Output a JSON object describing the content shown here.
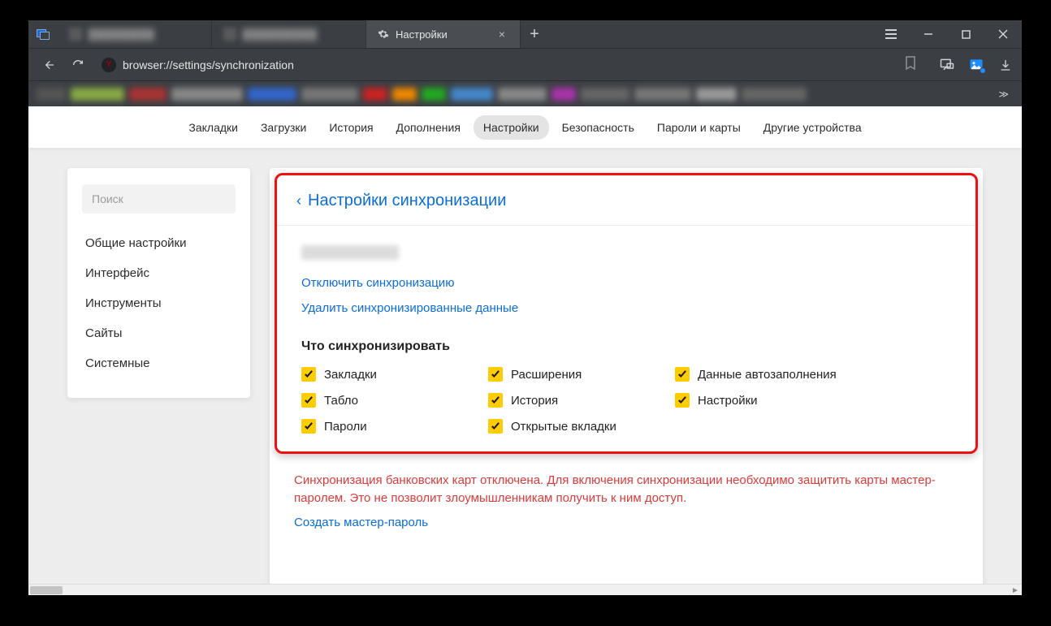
{
  "tabs": {
    "active_label": "Настройки",
    "close_glyph": "×",
    "new_tab_glyph": "+"
  },
  "address": {
    "url": "browser://settings/synchronization"
  },
  "topmenu": {
    "items": [
      "Закладки",
      "Загрузки",
      "История",
      "Дополнения",
      "Настройки",
      "Безопасность",
      "Пароли и карты",
      "Другие устройства"
    ],
    "active_index": 4
  },
  "sidebar": {
    "search_placeholder": "Поиск",
    "items": [
      "Общие настройки",
      "Интерфейс",
      "Инструменты",
      "Сайты",
      "Системные"
    ]
  },
  "panel": {
    "title": "Настройки синхронизации",
    "links": {
      "disable": "Отключить синхронизацию",
      "delete": "Удалить синхронизированные данные"
    },
    "sync_heading": "Что синхронизировать",
    "checks": {
      "col1": [
        "Закладки",
        "Табло",
        "Пароли"
      ],
      "col2": [
        "Расширения",
        "История",
        "Открытые вкладки"
      ],
      "col3": [
        "Данные автозаполнения",
        "Настройки"
      ]
    },
    "warning": "Синхронизация банковских карт отключена. Для включения синхронизации необходимо защитить карты мастер-паролем. Это не позволит злоумышленникам получить к ним доступ.",
    "warning_link": "Создать мастер-пароль"
  }
}
